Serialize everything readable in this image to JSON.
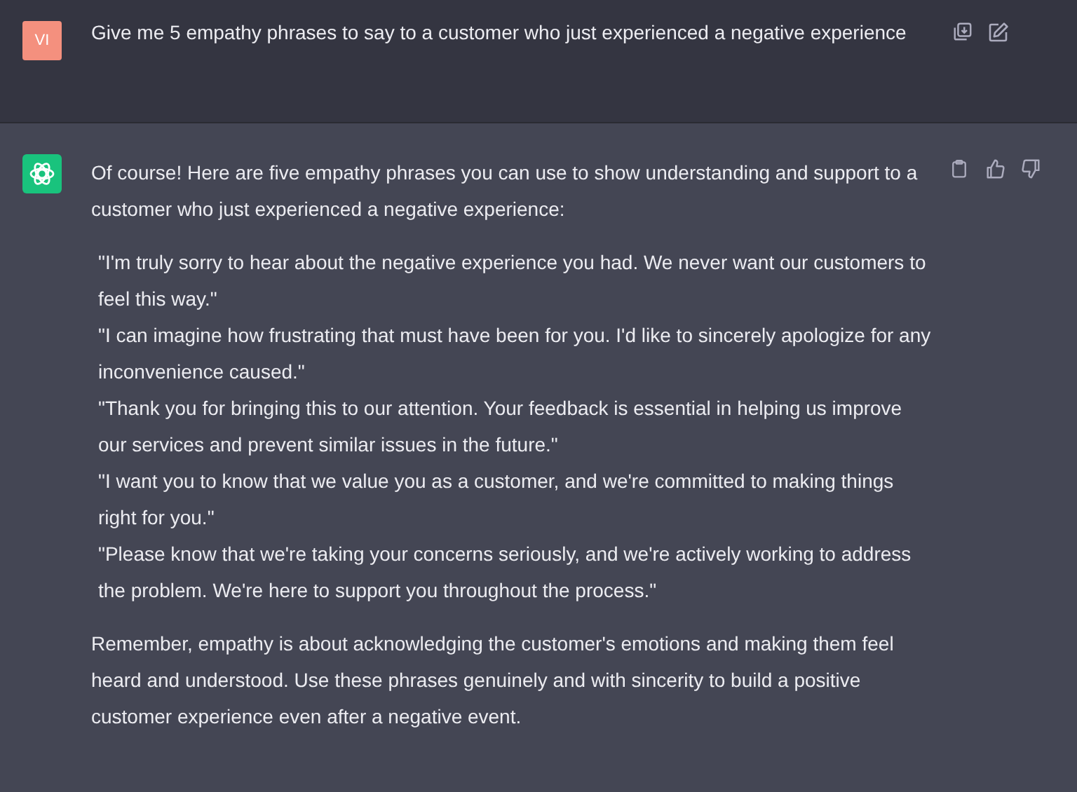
{
  "user_message": {
    "avatar": "VI",
    "text": "Give me 5 empathy phrases to say to a customer who just experienced a negative experience"
  },
  "assistant_message": {
    "intro": "Of course! Here are five empathy phrases you can use to show understanding and support to a customer who just experienced a negative experience:",
    "phrases": [
      "\"I'm truly sorry to hear about the negative experience you had. We never want our customers to feel this way.\"",
      "\"I can imagine how frustrating that must have been for you. I'd like to sincerely apologize for any inconvenience caused.\"",
      "\"Thank you for bringing this to our attention. Your feedback is essential in helping us improve our services and prevent similar issues in the future.\"",
      "\"I want you to know that we value you as a customer, and we're committed to making things right for you.\"",
      "\"Please know that we're taking your concerns seriously, and we're actively working to address the problem. We're here to support you throughout the process.\""
    ],
    "closing": "Remember, empathy is about acknowledging the customer's emotions and making them feel heard and understood. Use these phrases genuinely and with sincerity to build a positive customer experience even after a negative event."
  }
}
